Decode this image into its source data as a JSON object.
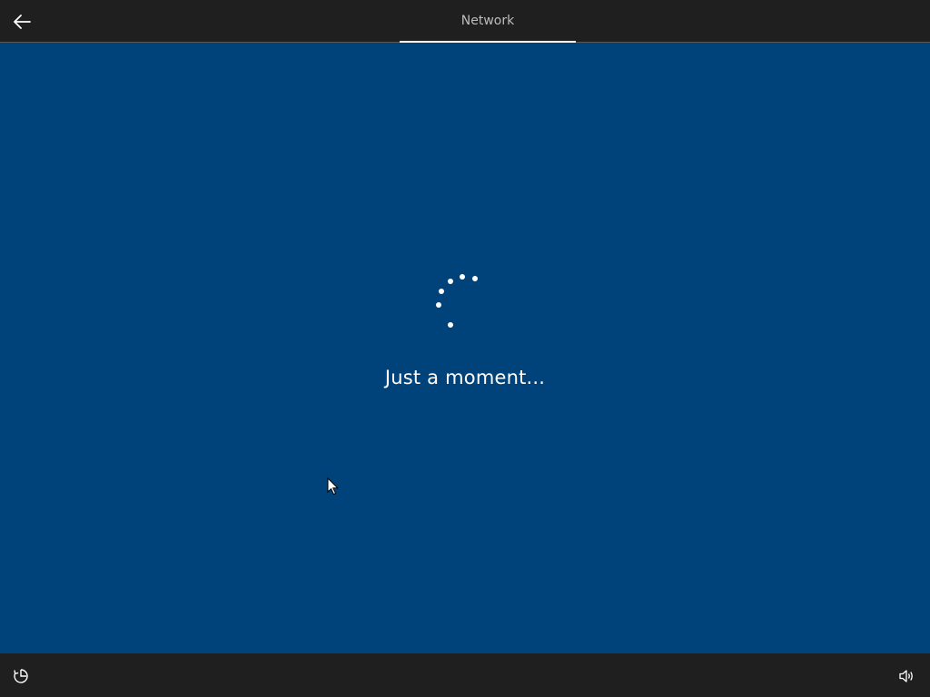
{
  "header": {
    "back_icon": "back-arrow-icon",
    "tab_label": "Network"
  },
  "main": {
    "spinner_icon": "loading-dots-icon",
    "status_text": "Just a moment..."
  },
  "footer": {
    "ease_of_access_icon": "ease-of-access-icon",
    "volume_icon": "volume-icon"
  },
  "colors": {
    "background": "#00437a",
    "bar": "#1f1f1f",
    "text": "#ffffff",
    "tab_text": "#bdbdbd"
  }
}
